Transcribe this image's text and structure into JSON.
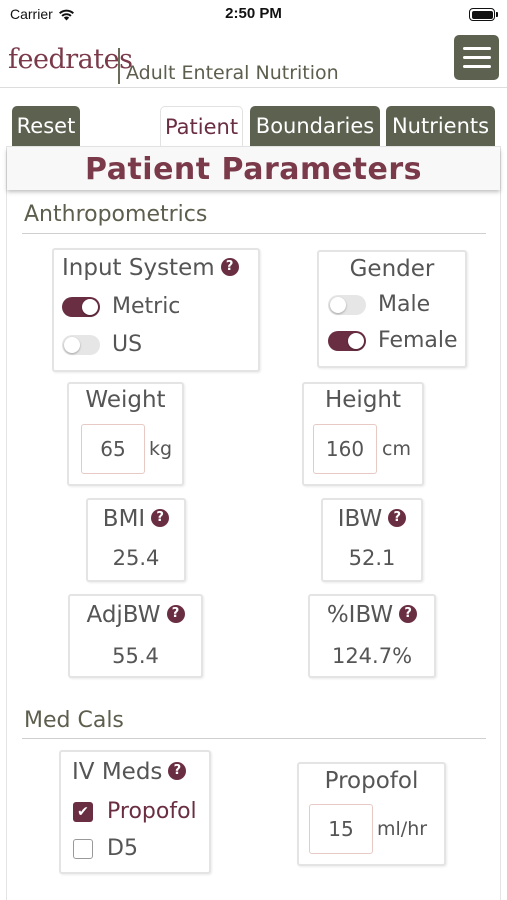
{
  "status": {
    "carrier": "Carrier",
    "time": "2:50 PM"
  },
  "header": {
    "logo": "feedrates",
    "subtitle": "Adult Enteral Nutrition"
  },
  "tabs": [
    {
      "label": "Reset"
    },
    {
      "label": "Patient"
    },
    {
      "label": "Boundaries"
    },
    {
      "label": "Nutrients"
    }
  ],
  "page_title": "Patient Parameters",
  "anthropometrics": {
    "section_title": "Anthropometrics",
    "input_system": {
      "label": "Input System",
      "options": [
        {
          "label": "Metric",
          "on": true
        },
        {
          "label": "US",
          "on": false
        }
      ]
    },
    "gender": {
      "label": "Gender",
      "options": [
        {
          "label": "Male",
          "on": false
        },
        {
          "label": "Female",
          "on": true
        }
      ]
    },
    "weight": {
      "label": "Weight",
      "value": "65",
      "unit": "kg"
    },
    "height": {
      "label": "Height",
      "value": "160",
      "unit": "cm"
    },
    "bmi": {
      "label": "BMI",
      "value": "25.4"
    },
    "ibw": {
      "label": "IBW",
      "value": "52.1"
    },
    "adjbw": {
      "label": "AdjBW",
      "value": "55.4"
    },
    "pct_ibw": {
      "label": "%IBW",
      "value": "124.7%"
    }
  },
  "med_cals": {
    "section_title": "Med Cals",
    "iv_meds": {
      "label": "IV Meds",
      "options": [
        {
          "label": "Propofol",
          "checked": true
        },
        {
          "label": "D5",
          "checked": false
        }
      ]
    },
    "propofol": {
      "label": "Propofol",
      "value": "15",
      "unit": "ml/hr"
    }
  },
  "colors": {
    "accent": "#6a2e42",
    "tab_bg": "#5d6250",
    "text": "#555555"
  },
  "icons": {
    "help": "question-circle-icon",
    "wifi": "wifi-icon",
    "battery": "battery-icon",
    "menu": "hamburger-menu-icon"
  }
}
